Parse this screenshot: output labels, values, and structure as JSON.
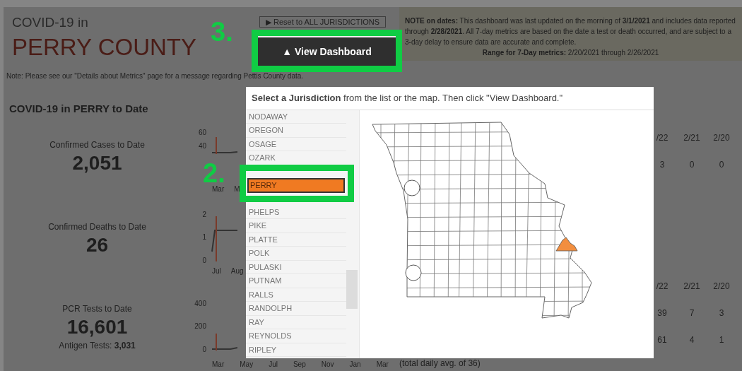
{
  "header": {
    "subtitle": "COVID-19 in",
    "title": "PERRY COUNTY"
  },
  "reset_button": "▶ Reset to ALL JURISDICTIONS",
  "view_button": "▲ View Dashboard",
  "date_note": [
    "**NOTE on dates:** This dashboard was last updated on the morning of **3/1/2021** and includes data reported through **2/28/2021**. All 7-day metrics are based on the date a test or death occurred, and are subject to a 3-day delay to ensure data are accurate and complete.",
    "**Range for 7-Day metrics:** 2/20/2021 through 2/26/2021"
  ],
  "metrics_note": "Note: Please see our \"Details about Metrics\" page for a message regarding Pettis County data.",
  "section_title": "COVID-19 in PERRY to Date",
  "metrics": [
    {
      "label": "Confirmed Cases to Date",
      "value": "2,051",
      "yticks": [
        "60",
        "40"
      ],
      "xticks": [
        "Mar",
        "M"
      ]
    },
    {
      "label": "Confirmed Deaths to Date",
      "value": "26",
      "yticks": [
        "2",
        "1",
        "0"
      ],
      "xticks": [
        "Jul",
        "Aug"
      ]
    },
    {
      "label": "PCR Tests to Date",
      "value": "16,601",
      "extra": "Antigen Tests: **3,031**",
      "yticks": [
        "400",
        "200",
        "0"
      ],
      "xticks": [
        "Mar",
        "May",
        "Jul",
        "Sep",
        "Nov",
        "Jan",
        "Mar"
      ]
    }
  ],
  "tables": [
    {
      "columns": [
        "/22",
        "2/21",
        "2/20"
      ],
      "rows": [
        [
          "3",
          "0",
          "0"
        ]
      ]
    },
    {
      "columns": [
        "/22",
        "2/21",
        "2/20"
      ],
      "rows": [
        [
          "39",
          "7",
          "3"
        ],
        [
          "61",
          "4",
          "1"
        ]
      ]
    }
  ],
  "footnote": "(total daily avg. of 36)",
  "picker": {
    "instruction": "**Select a Jurisdiction** from the list or the map. Then click \"View Dashboard.\"",
    "items": [
      {
        "label": "NODAWAY",
        "selected": false
      },
      {
        "label": "OREGON",
        "selected": false
      },
      {
        "label": "OSAGE",
        "selected": false
      },
      {
        "label": "OZARK",
        "selected": false
      },
      {
        "label": "PERRY",
        "selected": true
      },
      {
        "label": "PHELPS",
        "selected": false
      },
      {
        "label": "PIKE",
        "selected": false
      },
      {
        "label": "PLATTE",
        "selected": false
      },
      {
        "label": "POLK",
        "selected": false
      },
      {
        "label": "PULASKI",
        "selected": false
      },
      {
        "label": "PUTNAM",
        "selected": false
      },
      {
        "label": "RALLS",
        "selected": false
      },
      {
        "label": "RANDOLPH",
        "selected": false
      },
      {
        "label": "RAY",
        "selected": false
      },
      {
        "label": "REYNOLDS",
        "selected": false
      },
      {
        "label": "RIPLEY",
        "selected": false
      }
    ]
  },
  "annotations": [
    "3.",
    "2."
  ]
}
